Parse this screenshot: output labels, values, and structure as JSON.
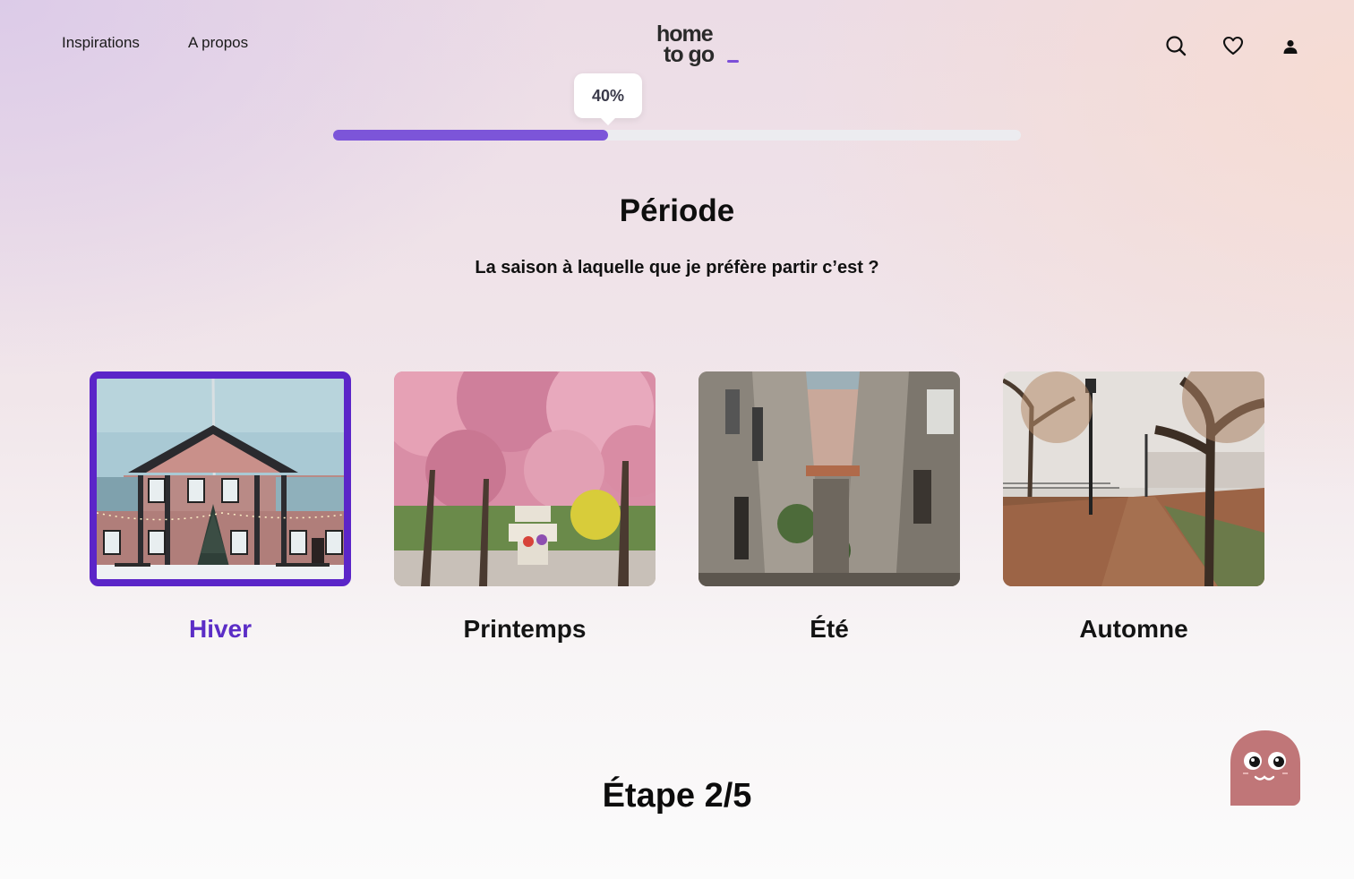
{
  "header": {
    "nav": [
      {
        "label": "Inspirations"
      },
      {
        "label": "A propos"
      }
    ],
    "logo": {
      "line1": "home",
      "line2": "to go",
      "accent": "#7c4fd8"
    },
    "icons": [
      "search-icon",
      "heart-icon",
      "user-icon"
    ]
  },
  "progress": {
    "label": "40%",
    "value": 0.4,
    "fill_color": "#7c55d9"
  },
  "question": {
    "title": "Période",
    "subtitle": "La saison à laquelle que je préfère partir c’est ?"
  },
  "options": [
    {
      "label": "Hiver",
      "selected": true
    },
    {
      "label": "Printemps",
      "selected": false
    },
    {
      "label": "Été",
      "selected": false
    },
    {
      "label": "Automne",
      "selected": false
    }
  ],
  "step": {
    "label": "Étape 2/5"
  },
  "colors": {
    "selected": "#5b25c8",
    "mascot": "#c07678"
  }
}
